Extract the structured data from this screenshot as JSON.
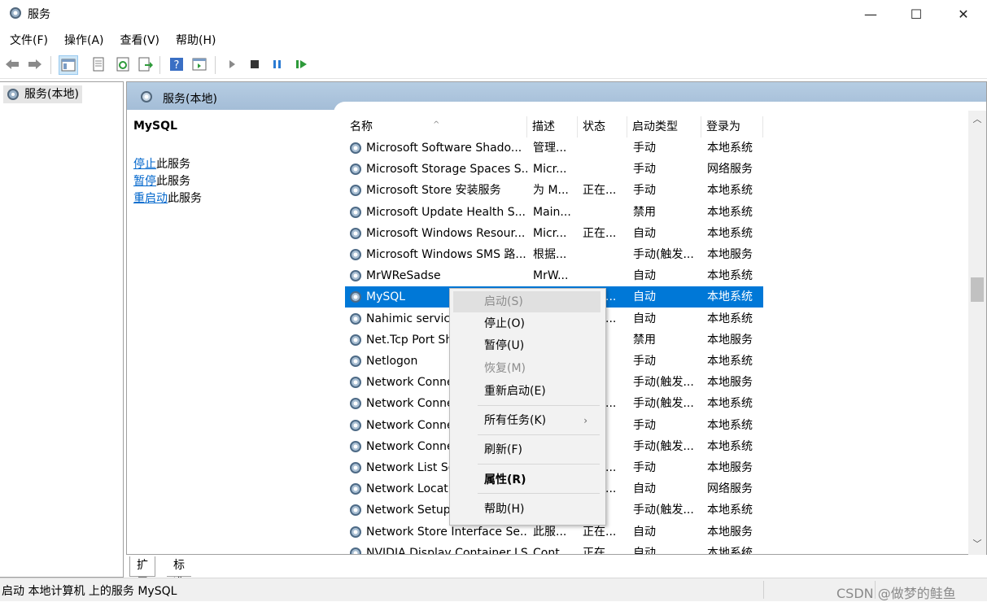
{
  "window": {
    "title": "服务",
    "min": "—",
    "max": "☐",
    "close": "✕"
  },
  "menu": [
    "文件(F)",
    "操作(A)",
    "查看(V)",
    "帮助(H)"
  ],
  "tree": {
    "root": "服务(本地)"
  },
  "pane": {
    "header": "服务(本地)",
    "selected_title": "MySQL",
    "actions": [
      {
        "link": "停止",
        "rest": "此服务"
      },
      {
        "link": "暂停",
        "rest": "此服务"
      },
      {
        "link": "重启动",
        "rest": "此服务"
      }
    ]
  },
  "columns": {
    "name": "名称",
    "desc": "描述",
    "state": "状态",
    "start": "启动类型",
    "logon": "登录为",
    "sort": "^"
  },
  "rows": [
    {
      "name": "Microsoft Software Shado...",
      "desc": "管理...",
      "state": "",
      "start": "手动",
      "logon": "本地系统"
    },
    {
      "name": "Microsoft Storage Spaces S...",
      "desc": "Micr...",
      "state": "",
      "start": "手动",
      "logon": "网络服务"
    },
    {
      "name": "Microsoft Store 安装服务",
      "desc": "为 M...",
      "state": "正在...",
      "start": "手动",
      "logon": "本地系统"
    },
    {
      "name": "Microsoft Update Health S...",
      "desc": "Main...",
      "state": "",
      "start": "禁用",
      "logon": "本地系统"
    },
    {
      "name": "Microsoft Windows Resour...",
      "desc": "Micr...",
      "state": "正在...",
      "start": "自动",
      "logon": "本地系统"
    },
    {
      "name": "Microsoft Windows SMS 路...",
      "desc": "根据...",
      "state": "",
      "start": "手动(触发...",
      "logon": "本地服务"
    },
    {
      "name": "MrWReSadse",
      "desc": "MrW...",
      "state": "",
      "start": "自动",
      "logon": "本地系统"
    },
    {
      "name": "MySQL",
      "desc": "",
      "state": "正在...",
      "start": "自动",
      "logon": "本地系统"
    },
    {
      "name": "Nahimic service",
      "desc": "",
      "state": "正在...",
      "start": "自动",
      "logon": "本地系统"
    },
    {
      "name": "Net.Tcp Port Sharing Service",
      "desc": "",
      "state": "",
      "start": "禁用",
      "logon": "本地服务"
    },
    {
      "name": "Netlogon",
      "desc": "",
      "state": "",
      "start": "手动",
      "logon": "本地系统"
    },
    {
      "name": "Network Connected Devices Auto-Setup",
      "desc": "",
      "state": "",
      "start": "手动(触发...",
      "logon": "本地服务"
    },
    {
      "name": "Network Connection Broker",
      "desc": "",
      "state": "正在...",
      "start": "手动(触发...",
      "logon": "本地系统"
    },
    {
      "name": "Network Connections",
      "desc": "",
      "state": "",
      "start": "手动",
      "logon": "本地系统"
    },
    {
      "name": "Network Connectivity Assistant",
      "desc": "",
      "state": "",
      "start": "手动(触发...",
      "logon": "本地系统"
    },
    {
      "name": "Network List Service",
      "desc": "",
      "state": "正在...",
      "start": "手动",
      "logon": "本地服务"
    },
    {
      "name": "Network Location Awareness",
      "desc": "",
      "state": "正在...",
      "start": "自动",
      "logon": "网络服务"
    },
    {
      "name": "Network Setup Service",
      "desc": "",
      "state": "",
      "start": "手动(触发...",
      "logon": "本地系统"
    },
    {
      "name": "Network Store Interface Se...",
      "desc": "此服...",
      "state": "正在...",
      "start": "自动",
      "logon": "本地服务"
    },
    {
      "name": "NVIDIA Display Container LS",
      "desc": "Cont...",
      "state": "正在...",
      "start": "自动",
      "logon": "本地系统"
    }
  ],
  "selected_row": 7,
  "context_menu": {
    "start": "启动(S)",
    "stop": "停止(O)",
    "pause": "暂停(U)",
    "resume": "恢复(M)",
    "restart": "重新启动(E)",
    "all_tasks": "所有任务(K)",
    "submenu_arrow": "›",
    "refresh": "刷新(F)",
    "properties": "属性(R)",
    "help": "帮助(H)"
  },
  "tabs": {
    "extended": "扩展",
    "standard": "标准"
  },
  "status": {
    "text": "启动 本地计算机 上的服务 MySQL"
  },
  "watermark": "CSDN @做梦的鲑鱼",
  "colors": {
    "selection": "#0078d7",
    "link": "#0066cc",
    "header": "#a4bdd7"
  },
  "icons": [
    "services-gear-icon",
    "back-arrow-icon",
    "forward-arrow-icon",
    "console-tree-icon",
    "properties-icon",
    "refresh-icon",
    "export-icon",
    "help-icon",
    "view-icon",
    "play-icon",
    "stop-icon",
    "pause-icon",
    "resume-icon"
  ]
}
